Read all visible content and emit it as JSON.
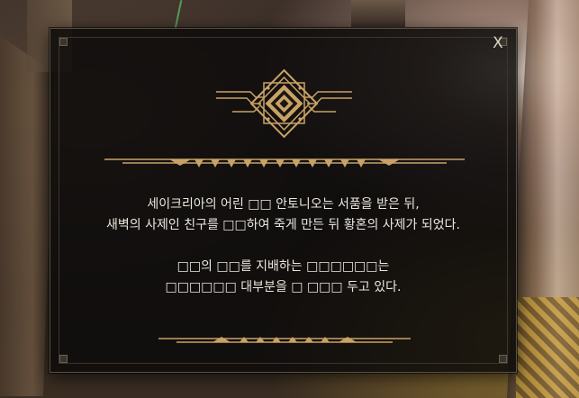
{
  "dialog": {
    "close_label": "X",
    "lines_block_1": [
      "세이크리아의 어린 □□ 안토니오는 서품을 받은 뒤,",
      "새벽의 사제인 친구를 □□하여 죽게 만든 뒤 황혼의 사제가 되었다."
    ],
    "lines_block_2": [
      "□□의 □□를 지배하는 □□□□□□는",
      "□□□□□□ 대부분을 □ □□□ 두고 있다."
    ]
  },
  "colors": {
    "gold": "#c8a266",
    "text": "#ece7df",
    "panel": "#0c0b0b"
  },
  "icons": {
    "emblem": "diamond-emblem-icon",
    "close": "close-icon"
  }
}
